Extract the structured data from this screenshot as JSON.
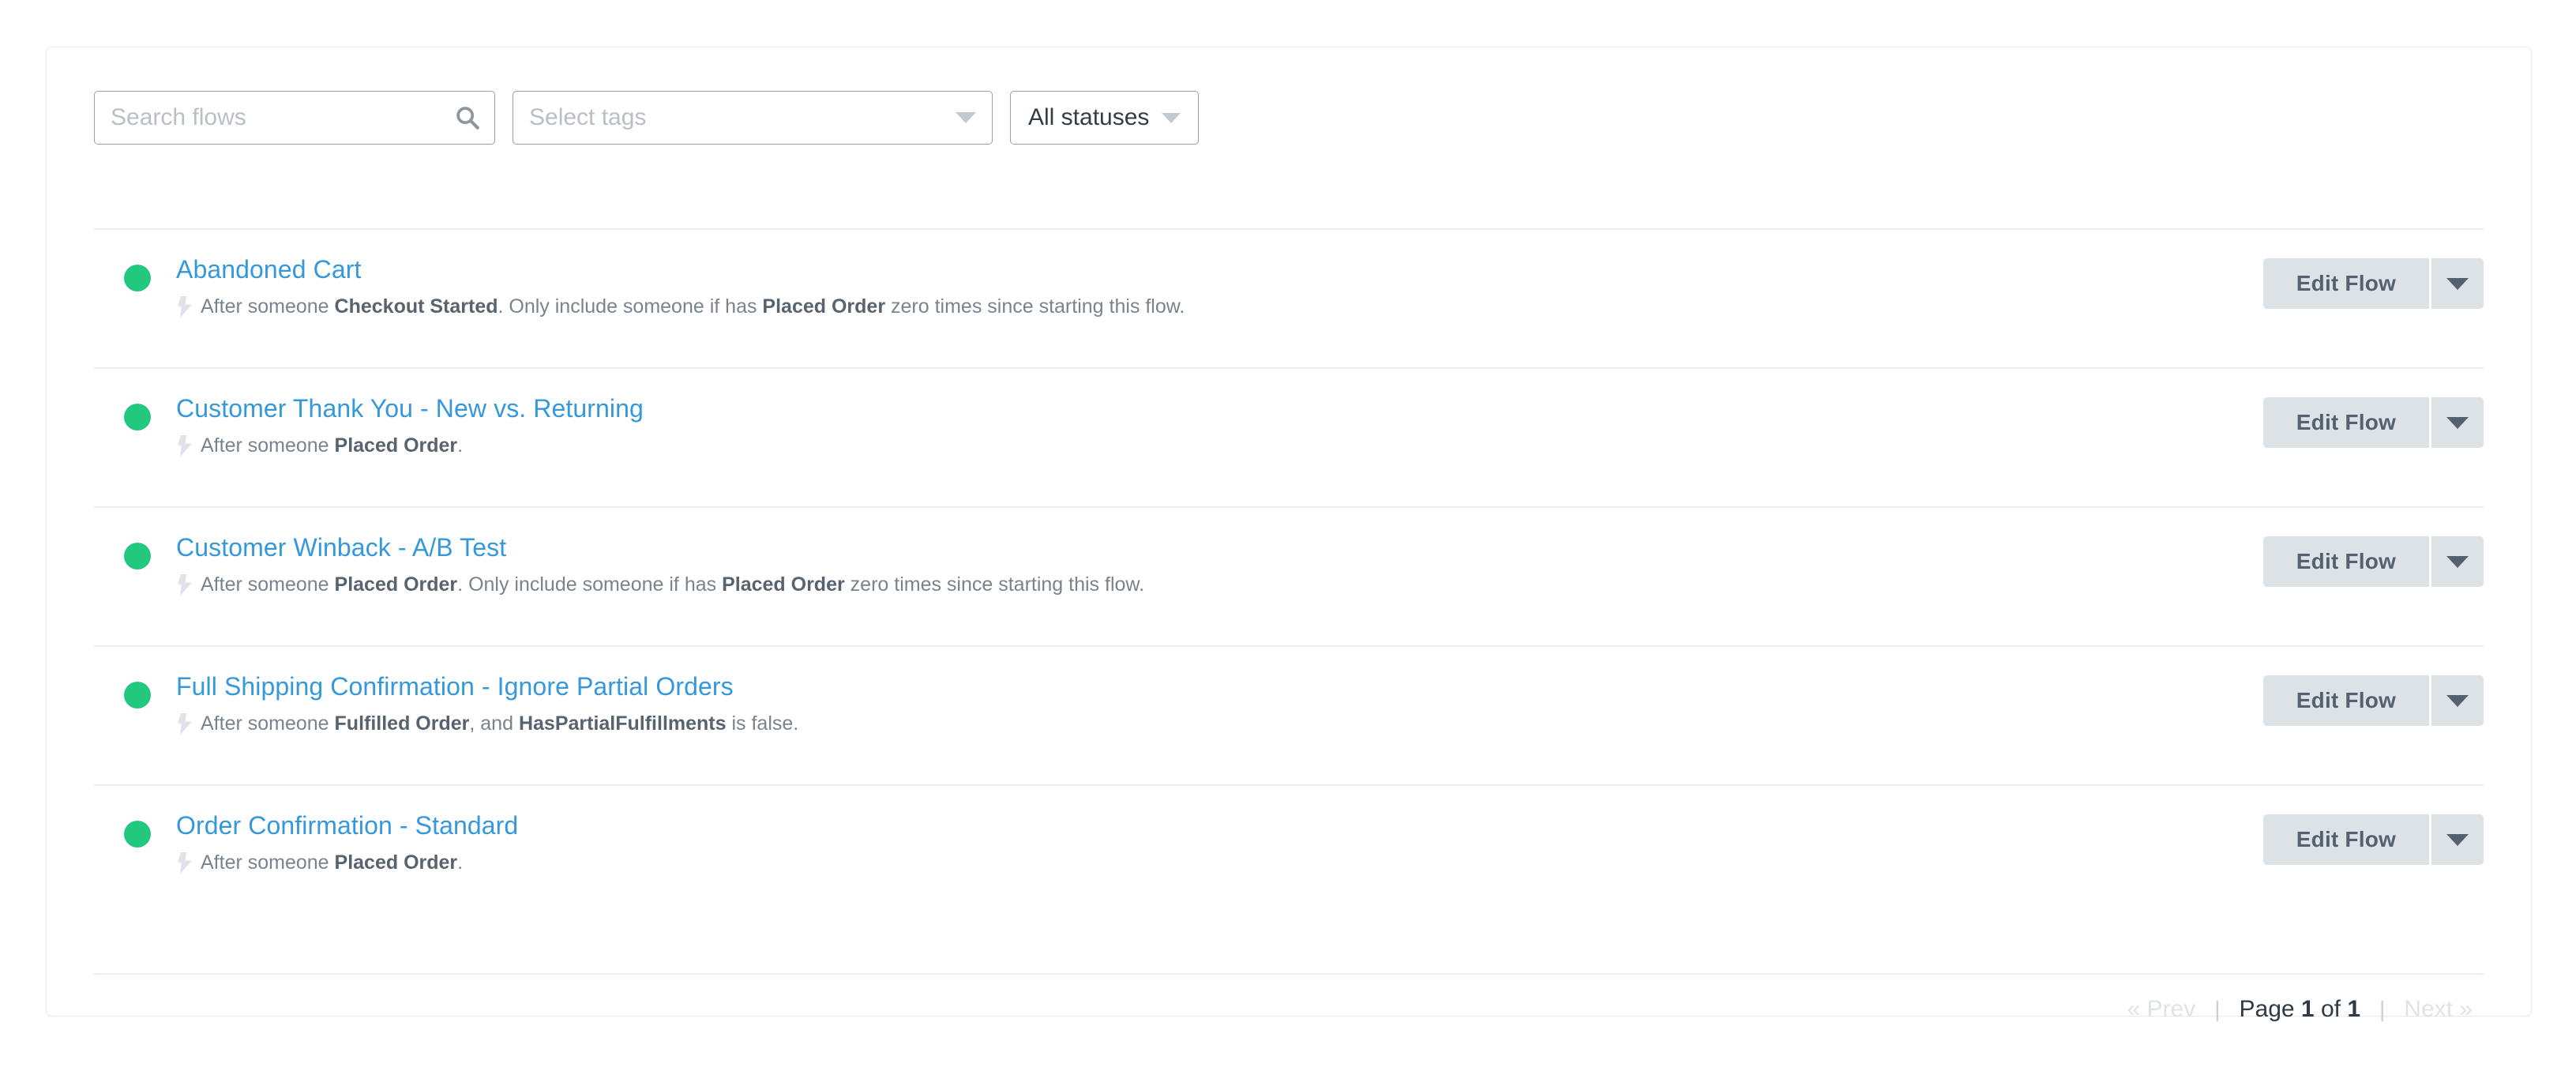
{
  "colors": {
    "accent_blue": "#3498db",
    "status_live_green": "#22c97d",
    "button_gray": "#dde2e7",
    "button_text": "#556070",
    "divider": "#eceff1",
    "muted_text": "#79838d"
  },
  "filters": {
    "search": {
      "placeholder": "Search flows",
      "value": "",
      "icon": "search-icon"
    },
    "tags": {
      "placeholder": "Select tags",
      "value": "",
      "icon": "chevron-down-icon"
    },
    "status": {
      "selected": "All statuses",
      "icon": "chevron-down-icon"
    }
  },
  "row_action": {
    "primary_label": "Edit Flow",
    "caret_icon": "chevron-down-icon"
  },
  "flows": [
    {
      "status": "live",
      "status_color": "#22c97d",
      "name": "Abandoned Cart",
      "trigger_icon": "lightning-bolt-icon",
      "description_parts": [
        {
          "text": "After someone ",
          "bold": false
        },
        {
          "text": "Checkout Started",
          "bold": true
        },
        {
          "text": ". Only include someone if has ",
          "bold": false
        },
        {
          "text": "Placed Order",
          "bold": true
        },
        {
          "text": " zero times since starting this flow.",
          "bold": false
        }
      ]
    },
    {
      "status": "live",
      "status_color": "#22c97d",
      "name": "Customer Thank You - New vs. Returning",
      "trigger_icon": "lightning-bolt-icon",
      "description_parts": [
        {
          "text": "After someone ",
          "bold": false
        },
        {
          "text": "Placed Order",
          "bold": true
        },
        {
          "text": ".",
          "bold": false
        }
      ]
    },
    {
      "status": "live",
      "status_color": "#22c97d",
      "name": "Customer Winback - A/B Test",
      "trigger_icon": "lightning-bolt-icon",
      "description_parts": [
        {
          "text": "After someone ",
          "bold": false
        },
        {
          "text": "Placed Order",
          "bold": true
        },
        {
          "text": ". Only include someone if has ",
          "bold": false
        },
        {
          "text": "Placed Order",
          "bold": true
        },
        {
          "text": " zero times since starting this flow.",
          "bold": false
        }
      ]
    },
    {
      "status": "live",
      "status_color": "#22c97d",
      "name": "Full Shipping Confirmation - Ignore Partial Orders",
      "trigger_icon": "lightning-bolt-icon",
      "description_parts": [
        {
          "text": "After someone ",
          "bold": false
        },
        {
          "text": "Fulfilled Order",
          "bold": true
        },
        {
          "text": ", and ",
          "bold": false
        },
        {
          "text": "HasPartialFulfillments",
          "bold": true
        },
        {
          "text": " is false.",
          "bold": false
        }
      ]
    },
    {
      "status": "live",
      "status_color": "#22c97d",
      "name": "Order Confirmation - Standard",
      "trigger_icon": "lightning-bolt-icon",
      "description_parts": [
        {
          "text": "After someone ",
          "bold": false
        },
        {
          "text": "Placed Order",
          "bold": true
        },
        {
          "text": ".",
          "bold": false
        }
      ]
    }
  ],
  "pagination": {
    "prev_label": "« Prev",
    "prev_enabled": false,
    "separator": "|",
    "page_prefix": "Page ",
    "current_page": "1",
    "page_mid": " of ",
    "total_pages": "1",
    "next_label": "Next »",
    "next_enabled": false
  }
}
